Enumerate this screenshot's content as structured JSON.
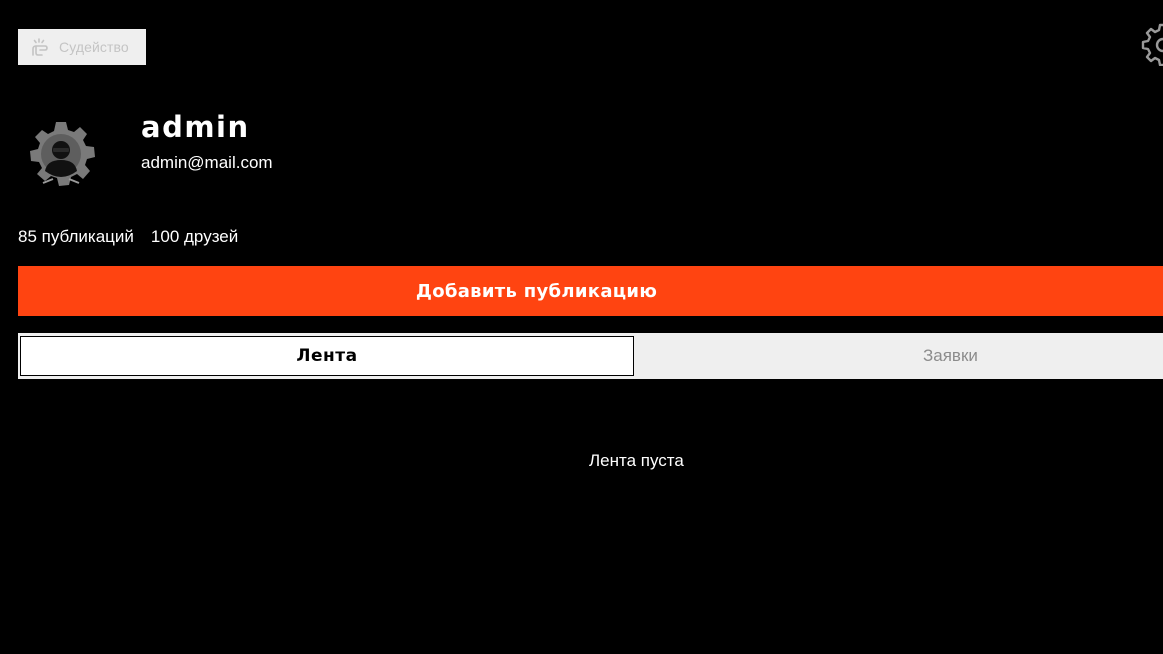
{
  "header": {
    "judge_label": "Судейство",
    "judge_icon": "pointing-hand-icon",
    "settings_icon": "gear-icon"
  },
  "profile": {
    "avatar_icon": "user-avatar-gear-icon",
    "username": "admin",
    "email": "admin@mail.com",
    "publications": "85 публикаций",
    "friends": "100 друзей"
  },
  "actions": {
    "add_publication_label": "Добавить публикацию"
  },
  "tabs": [
    {
      "label": "Лента",
      "active": true
    },
    {
      "label": "Заявки",
      "active": false
    }
  ],
  "feed": {
    "empty_text": "Лента пуста"
  },
  "colors": {
    "background": "#000000",
    "accent": "#ff4411",
    "tab_background": "#efefef",
    "muted_text": "#8c8c8c"
  }
}
